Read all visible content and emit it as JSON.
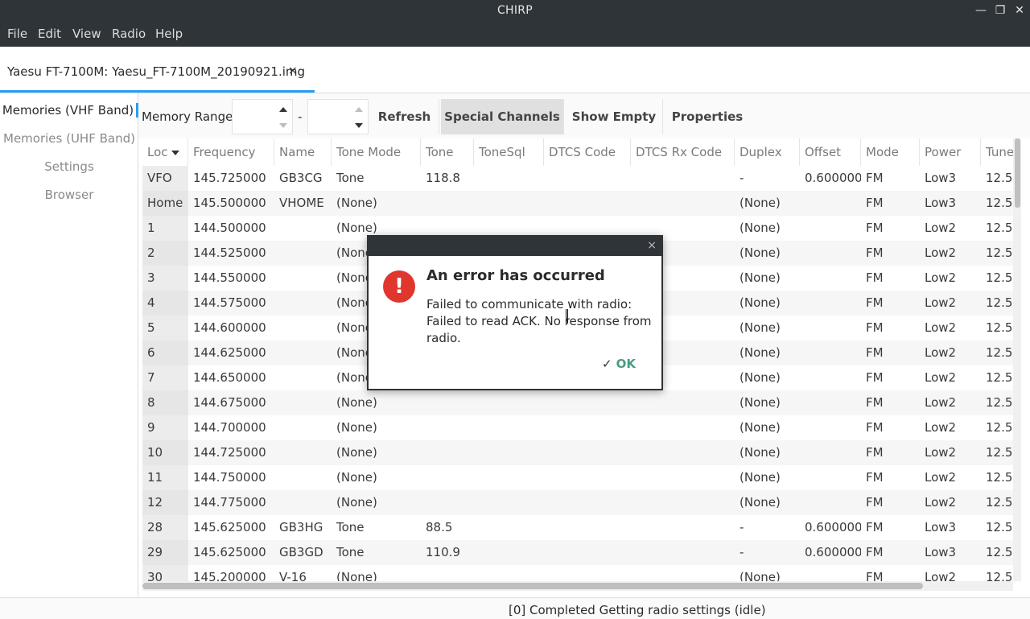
{
  "window": {
    "title": "CHIRP",
    "min_icon": "minimize-icon",
    "max_icon": "maximize-icon",
    "close_icon": "close-icon",
    "min_glyph": "—",
    "max_glyph": "❐",
    "close_glyph": "✕"
  },
  "menubar": {
    "items": [
      "File",
      "Edit",
      "View",
      "Radio",
      "Help"
    ]
  },
  "tab": {
    "label": "Yaesu FT-7100M: Yaesu_FT-7100M_20190921.img",
    "close_glyph": "×"
  },
  "sidenav": {
    "items": [
      "Memories (VHF Band)",
      "Memories (UHF Band)",
      "Settings",
      "Browser"
    ],
    "active": "Memories (VHF Band)"
  },
  "toolbar": {
    "memory_range_label": "Memory Range:",
    "range_start_value": "",
    "range_end_value": "",
    "dash": "-",
    "refresh_label": "Refresh",
    "special_channels_label": "Special Channels",
    "show_empty_label": "Show Empty",
    "properties_label": "Properties"
  },
  "table": {
    "columns": [
      "Loc",
      "Frequency",
      "Name",
      "Tone Mode",
      "Tone",
      "ToneSql",
      "DTCS Code",
      "DTCS Rx Code",
      "Duplex",
      "Offset",
      "Mode",
      "Power",
      "Tune"
    ],
    "sort_column": "Loc",
    "rows": [
      [
        "VFO",
        "145.725000",
        "GB3CG",
        "Tone",
        "118.8",
        "",
        "",
        "",
        "-",
        "0.600000",
        "FM",
        "Low3",
        "12.5"
      ],
      [
        "Home",
        "145.500000",
        "VHOME",
        "(None)",
        "",
        "",
        "",
        "",
        "(None)",
        "",
        "FM",
        "Low3",
        "12.5"
      ],
      [
        "1",
        "144.500000",
        "",
        "(None)",
        "",
        "",
        "",
        "",
        "(None)",
        "",
        "FM",
        "Low2",
        "12.5"
      ],
      [
        "2",
        "144.525000",
        "",
        "(None)",
        "",
        "",
        "",
        "",
        "(None)",
        "",
        "FM",
        "Low2",
        "12.5"
      ],
      [
        "3",
        "144.550000",
        "",
        "(None)",
        "",
        "",
        "",
        "",
        "(None)",
        "",
        "FM",
        "Low2",
        "12.5"
      ],
      [
        "4",
        "144.575000",
        "",
        "(None)",
        "",
        "",
        "",
        "",
        "(None)",
        "",
        "FM",
        "Low2",
        "12.5"
      ],
      [
        "5",
        "144.600000",
        "",
        "(None)",
        "",
        "",
        "",
        "",
        "(None)",
        "",
        "FM",
        "Low2",
        "12.5"
      ],
      [
        "6",
        "144.625000",
        "",
        "(None)",
        "",
        "",
        "",
        "",
        "(None)",
        "",
        "FM",
        "Low2",
        "12.5"
      ],
      [
        "7",
        "144.650000",
        "",
        "(None)",
        "",
        "",
        "",
        "",
        "(None)",
        "",
        "FM",
        "Low2",
        "12.5"
      ],
      [
        "8",
        "144.675000",
        "",
        "(None)",
        "",
        "",
        "",
        "",
        "(None)",
        "",
        "FM",
        "Low2",
        "12.5"
      ],
      [
        "9",
        "144.700000",
        "",
        "(None)",
        "",
        "",
        "",
        "",
        "(None)",
        "",
        "FM",
        "Low2",
        "12.5"
      ],
      [
        "10",
        "144.725000",
        "",
        "(None)",
        "",
        "",
        "",
        "",
        "(None)",
        "",
        "FM",
        "Low2",
        "12.5"
      ],
      [
        "11",
        "144.750000",
        "",
        "(None)",
        "",
        "",
        "",
        "",
        "(None)",
        "",
        "FM",
        "Low2",
        "12.5"
      ],
      [
        "12",
        "144.775000",
        "",
        "(None)",
        "",
        "",
        "",
        "",
        "(None)",
        "",
        "FM",
        "Low2",
        "12.5"
      ],
      [
        "28",
        "145.625000",
        "GB3HG",
        "Tone",
        "88.5",
        "",
        "",
        "",
        "-",
        "0.600000",
        "FM",
        "Low3",
        "12.5"
      ],
      [
        "29",
        "145.625000",
        "GB3GD",
        "Tone",
        "110.9",
        "",
        "",
        "",
        "-",
        "0.600000",
        "FM",
        "Low3",
        "12.5"
      ],
      [
        "30",
        "145.200000",
        "V-16",
        "(None)",
        "",
        "",
        "",
        "",
        "(None)",
        "",
        "FM",
        "Low2",
        "12.5"
      ]
    ]
  },
  "status": {
    "text": "[0] Completed Getting radio settings (idle)"
  },
  "dialog": {
    "title": "An error has occurred",
    "message": "Failed to communicate with radio: Failed to read ACK. No response from radio.",
    "ok_label": "OK",
    "icon_glyph": "!",
    "close_glyph": "×",
    "check_glyph": "✓",
    "error_color": "#e0362d"
  },
  "colors": {
    "accent": "#2a9df4",
    "titlebar": "#2f3438",
    "ok_text": "#4a9a84"
  }
}
